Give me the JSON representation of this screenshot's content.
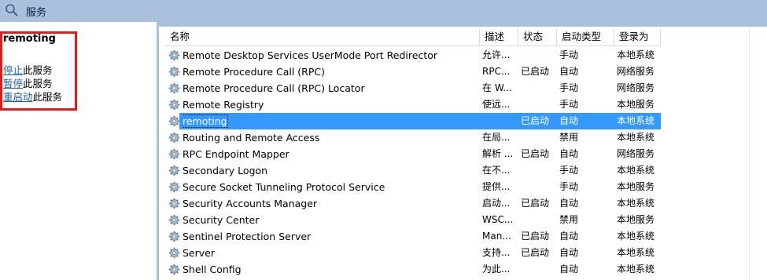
{
  "header": {
    "title": "服务",
    "icon": "search-icon"
  },
  "left_pane": {
    "service_name": "remoting",
    "actions": [
      {
        "link": "停止",
        "suffix": "此服务"
      },
      {
        "link": "暂停",
        "suffix": "此服务"
      },
      {
        "link": "重启动",
        "suffix": "此服务"
      }
    ]
  },
  "columns": {
    "name": "名称",
    "description": "描述",
    "status": "状态",
    "startup_type": "启动类型",
    "log_on_as": "登录为"
  },
  "services": [
    {
      "name": "Remote Desktop Services UserMode Port Redirector",
      "description": "允许...",
      "status": "",
      "startup": "手动",
      "logon": "本地系统"
    },
    {
      "name": "Remote Procedure Call (RPC)",
      "description": "RPC...",
      "status": "已启动",
      "startup": "自动",
      "logon": "网络服务"
    },
    {
      "name": "Remote Procedure Call (RPC) Locator",
      "description": "在 W...",
      "status": "",
      "startup": "手动",
      "logon": "网络服务"
    },
    {
      "name": "Remote Registry",
      "description": "使远...",
      "status": "",
      "startup": "手动",
      "logon": "本地服务"
    },
    {
      "name": "remoting",
      "description": "",
      "status": "已启动",
      "startup": "自动",
      "logon": "本地系统",
      "selected": true
    },
    {
      "name": "Routing and Remote Access",
      "description": "在局...",
      "status": "",
      "startup": "禁用",
      "logon": "本地系统"
    },
    {
      "name": "RPC Endpoint Mapper",
      "description": "解析 ...",
      "status": "已启动",
      "startup": "自动",
      "logon": "网络服务"
    },
    {
      "name": "Secondary Logon",
      "description": "在不...",
      "status": "",
      "startup": "手动",
      "logon": "本地系统"
    },
    {
      "name": "Secure Socket Tunneling Protocol Service",
      "description": "提供...",
      "status": "",
      "startup": "手动",
      "logon": "本地服务"
    },
    {
      "name": "Security Accounts Manager",
      "description": "启动...",
      "status": "已启动",
      "startup": "自动",
      "logon": "本地系统"
    },
    {
      "name": "Security Center",
      "description": "WSC...",
      "status": "",
      "startup": "禁用",
      "logon": "本地服务"
    },
    {
      "name": "Sentinel Protection Server",
      "description": "Man...",
      "status": "已启动",
      "startup": "自动",
      "logon": "本地系统"
    },
    {
      "name": "Server",
      "description": "支持...",
      "status": "已启动",
      "startup": "自动",
      "logon": "本地系统"
    },
    {
      "name": "Shell Config",
      "description": "为此...",
      "status": "",
      "startup": "自动",
      "logon": "本地系统"
    }
  ],
  "colors": {
    "header_bg": "#aac1dc",
    "selection": "#3399ff",
    "highlight_box": "#e21b1b",
    "link": "#1a5fb4"
  }
}
